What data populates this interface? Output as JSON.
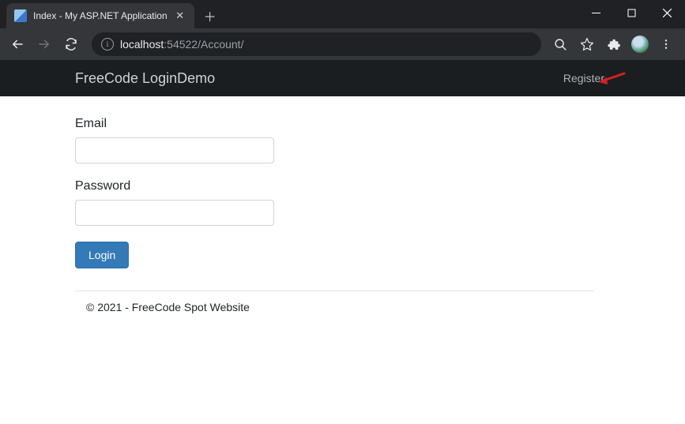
{
  "browser": {
    "tab_title": "Index - My ASP.NET Application",
    "url_host": "localhost",
    "url_port": ":54522",
    "url_path": "/Account/"
  },
  "navbar": {
    "brand": "FreeCode LoginDemo",
    "register_link": "Register"
  },
  "form": {
    "email_label": "Email",
    "email_value": "",
    "password_label": "Password",
    "password_value": "",
    "submit_label": "Login"
  },
  "footer": {
    "text": "© 2021 - FreeCode Spot Website"
  }
}
